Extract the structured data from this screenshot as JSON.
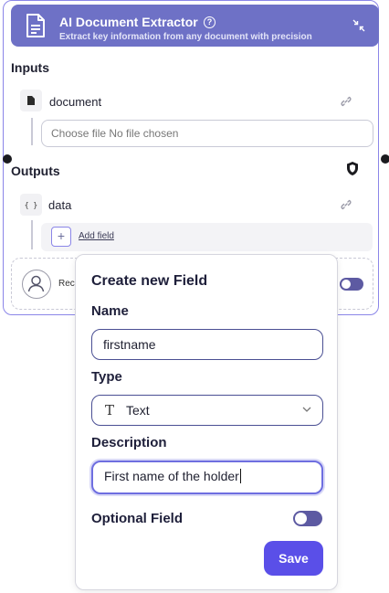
{
  "node": {
    "title": "AI Document Extractor",
    "subtitle": "Extract key information from any document with precision",
    "help_glyph": "?",
    "icons": {
      "header": "document-icon",
      "help": "help-circle-icon",
      "collapse": "collapse-icon"
    }
  },
  "inputs": {
    "section_title": "Inputs",
    "param": {
      "icon": "file-icon",
      "name": "document",
      "link_icon": "link-icon"
    },
    "file_input": {
      "text": "Choose file No file chosen"
    }
  },
  "outputs": {
    "section_title": "Outputs",
    "shield_icon": "shield-icon",
    "param": {
      "icon_glyph": "{ }",
      "name": "data",
      "link_icon": "link-icon"
    },
    "add_field": {
      "plus": "+",
      "label": "Add field"
    }
  },
  "behind_card": {
    "text_fragment": "Rec",
    "avatar_icon": "user-icon",
    "toggle_on": true
  },
  "popover": {
    "title": "Create new Field",
    "name": {
      "label": "Name",
      "value": "firstname"
    },
    "type": {
      "label": "Type",
      "icon_glyph": "T",
      "value": "Text",
      "chevron_icon": "chevron-down-icon"
    },
    "description": {
      "label": "Description",
      "value": "First name of the holder"
    },
    "optional": {
      "label": "Optional Field",
      "toggle_on": true
    },
    "save_label": "Save"
  },
  "colors": {
    "header_bg": "#6e71c6",
    "card_border": "#8b86e8",
    "toggle": "#5d5aa2",
    "save_bg": "#5a4fe8"
  }
}
